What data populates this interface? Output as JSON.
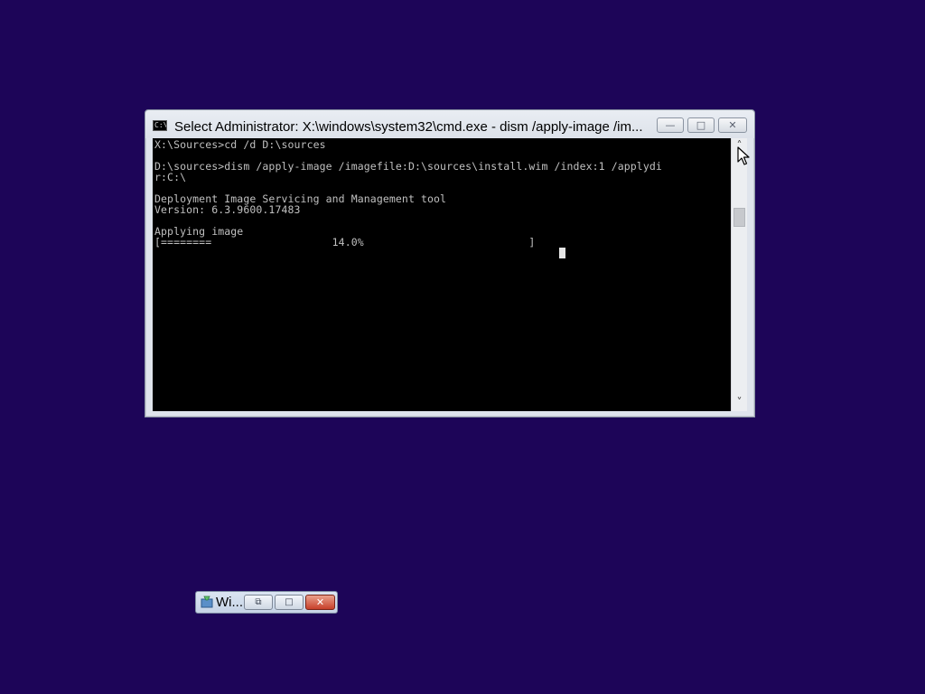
{
  "desktop": {
    "background_color": "#1d0558"
  },
  "cmd_window": {
    "icon_glyph": "C:\\",
    "title": "Select Administrator: X:\\windows\\system32\\cmd.exe - dism  /apply-image /im...",
    "buttons": {
      "minimize": "—",
      "maximize": "□",
      "close": "✕"
    },
    "console_lines": [
      "X:\\Sources>cd /d D:\\sources",
      "",
      "D:\\sources>dism /apply-image /imagefile:D:\\sources\\install.wim /index:1 /applydi",
      "r:C:\\",
      "",
      "Deployment Image Servicing and Management tool",
      "Version: 6.3.9600.17483",
      "",
      "Applying image",
      "[========                   14.0%                          ]"
    ],
    "progress_percent": 14.0,
    "scrollbar": {
      "up_arrow": "˄",
      "down_arrow": "˅"
    }
  },
  "mini_window": {
    "title": "Wi...",
    "icon": "setup-icon",
    "buttons": {
      "restore": "⧉",
      "maximize": "□",
      "close": "✕"
    }
  }
}
